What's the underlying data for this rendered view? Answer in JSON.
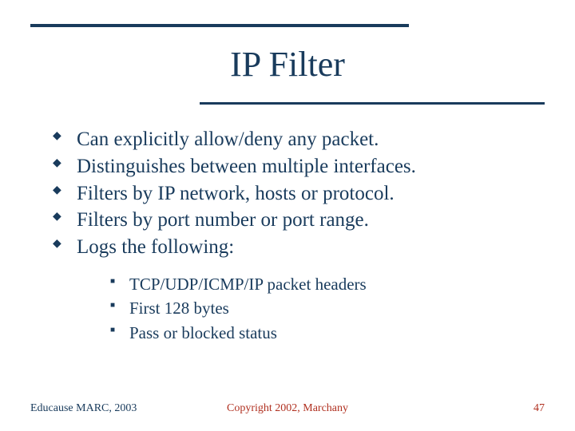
{
  "title": "IP Filter",
  "bullets": [
    "Can explicitly allow/deny any packet.",
    "Distinguishes between multiple interfaces.",
    "Filters by IP network, hosts or protocol.",
    "Filters by port number or port range.",
    "Logs the following:"
  ],
  "subbullets": [
    "TCP/UDP/ICMP/IP packet headers",
    "First 128 bytes",
    "Pass or blocked status"
  ],
  "footer": {
    "left": "Educause MARC, 2003",
    "center": "Copyright 2002, Marchany",
    "right": "47"
  }
}
